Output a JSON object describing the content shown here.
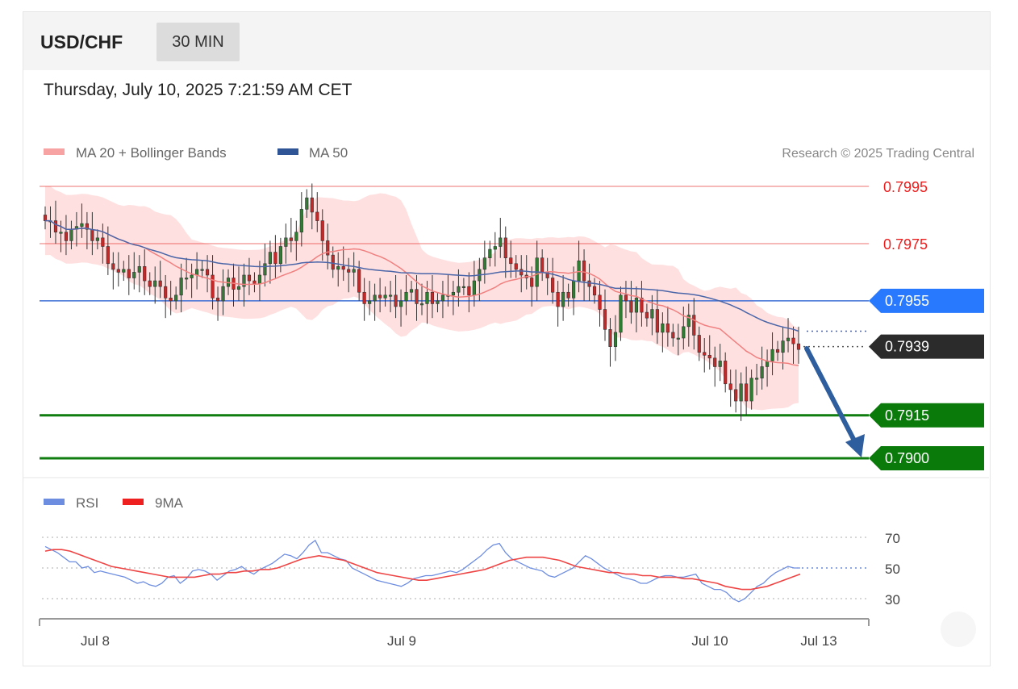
{
  "header": {
    "symbol": "USD/CHF",
    "timeframe": "30 MIN",
    "datetime": "Thursday, July 10, 2025 7:21:59 AM CET"
  },
  "legend": {
    "ma20_bb": "MA 20 + Bollinger Bands",
    "ma50": "MA 50",
    "credit": "Research © 2025 Trading Central"
  },
  "rsi_legend": {
    "rsi": "RSI",
    "ma9": "9MA"
  },
  "colors": {
    "bull": "#2e7d32",
    "bear": "#c62828",
    "band": "#ffd6d6",
    "ma20": "#f08080",
    "ma50": "#4a66a8",
    "resistance": "#e53935",
    "pivot": "#2979ff",
    "support": "#0a7a0a",
    "current": "#2b2b2b",
    "arrow": "#2e5e9e",
    "rsi": "#6d8de0",
    "rsi_ma": "#ef4444"
  },
  "chart_data": [
    {
      "type": "candlestick",
      "title": "USD/CHF 30 MIN",
      "ylim": [
        0.7892,
        0.8005
      ],
      "x_ticks": [
        "Jul 8",
        "Jul 9",
        "Jul 10",
        "Jul 13"
      ],
      "levels": [
        {
          "value": 0.7995,
          "label": "0.7995",
          "role": "resistance"
        },
        {
          "value": 0.7975,
          "label": "0.7975",
          "role": "resistance"
        },
        {
          "value": 0.7955,
          "label": "0.7955",
          "role": "pivot"
        },
        {
          "value": 0.7939,
          "label": "0.7939",
          "role": "current"
        },
        {
          "value": 0.7915,
          "label": "0.7915",
          "role": "support"
        },
        {
          "value": 0.79,
          "label": "0.7900",
          "role": "support"
        }
      ],
      "closes": [
        0.7983,
        0.7983,
        0.7979,
        0.7979,
        0.7976,
        0.798,
        0.7981,
        0.7982,
        0.798,
        0.7976,
        0.7977,
        0.7974,
        0.7968,
        0.7966,
        0.7965,
        0.7966,
        0.7963,
        0.7965,
        0.7967,
        0.7962,
        0.796,
        0.7962,
        0.796,
        0.7956,
        0.7955,
        0.7957,
        0.7963,
        0.7963,
        0.7964,
        0.7966,
        0.7966,
        0.7964,
        0.7956,
        0.7955,
        0.796,
        0.7963,
        0.7959,
        0.796,
        0.7964,
        0.7962,
        0.7961,
        0.7964,
        0.7968,
        0.7972,
        0.7968,
        0.7974,
        0.7977,
        0.7976,
        0.7979,
        0.7987,
        0.7991,
        0.7986,
        0.7983,
        0.7976,
        0.7971,
        0.7966,
        0.7967,
        0.7966,
        0.7965,
        0.7966,
        0.7958,
        0.7954,
        0.7955,
        0.7957,
        0.7956,
        0.7957,
        0.7957,
        0.7953,
        0.7955,
        0.7958,
        0.7959,
        0.7954,
        0.7954,
        0.7958,
        0.7954,
        0.7955,
        0.7957,
        0.7957,
        0.7958,
        0.796,
        0.796,
        0.7957,
        0.7962,
        0.7966,
        0.797,
        0.7973,
        0.7974,
        0.7977,
        0.797,
        0.7968,
        0.7966,
        0.7964,
        0.7963,
        0.796,
        0.797,
        0.7965,
        0.7963,
        0.7958,
        0.7953,
        0.7958,
        0.7956,
        0.7962,
        0.7969,
        0.7962,
        0.796,
        0.7957,
        0.7952,
        0.7945,
        0.7939,
        0.7944,
        0.7957,
        0.7955,
        0.7951,
        0.7956,
        0.7951,
        0.7949,
        0.7952,
        0.7944,
        0.7947,
        0.7944,
        0.7942,
        0.7942,
        0.7946,
        0.795,
        0.7943,
        0.7937,
        0.7936,
        0.7935,
        0.7932,
        0.7934,
        0.7926,
        0.7924,
        0.792,
        0.7926,
        0.792,
        0.7928,
        0.7928,
        0.7932,
        0.7934,
        0.7938,
        0.7937,
        0.7941,
        0.7942,
        0.794,
        0.7938
      ]
    },
    {
      "type": "line",
      "title": "RSI",
      "ylim": [
        20,
        80
      ],
      "y_ticks": [
        30,
        50,
        70
      ],
      "series": [
        {
          "name": "RSI",
          "values": [
            64,
            62,
            60,
            57,
            54,
            54,
            50,
            51,
            47,
            48,
            47,
            46,
            45,
            44,
            42,
            40,
            41,
            39,
            38,
            40,
            44,
            45,
            40,
            43,
            48,
            49,
            48,
            46,
            42,
            45,
            48,
            49,
            51,
            48,
            46,
            49,
            51,
            53,
            56,
            59,
            58,
            56,
            60,
            65,
            68,
            60,
            60,
            58,
            56,
            55,
            50,
            48,
            46,
            44,
            42,
            41,
            40,
            39,
            38,
            40,
            43,
            44,
            45,
            45,
            46,
            47,
            48,
            47,
            49,
            52,
            55,
            58,
            62,
            65,
            66,
            60,
            56,
            54,
            52,
            50,
            49,
            48,
            45,
            44,
            46,
            48,
            50,
            54,
            58,
            56,
            53,
            50,
            48,
            46,
            44,
            43,
            42,
            40,
            40,
            42,
            44,
            45,
            45,
            44,
            44,
            45,
            46,
            40,
            38,
            36,
            36,
            34,
            30,
            28,
            30,
            34,
            38,
            40,
            44,
            47,
            49,
            51,
            50,
            50
          ]
        },
        {
          "name": "9MA",
          "values": [
            61,
            62,
            62,
            61,
            59,
            57,
            55,
            53,
            51,
            50,
            49,
            48,
            47,
            46,
            45,
            44,
            44,
            44,
            44,
            45,
            46,
            46,
            47,
            47,
            48,
            48,
            49,
            49,
            50,
            52,
            54,
            56,
            57,
            58,
            57,
            56,
            55,
            53,
            51,
            49,
            47,
            46,
            45,
            44,
            43,
            42,
            42,
            43,
            44,
            45,
            46,
            47,
            48,
            49,
            51,
            53,
            55,
            56,
            57,
            57,
            57,
            56,
            55,
            53,
            51,
            50,
            49,
            48,
            47,
            47,
            46,
            46,
            45,
            45,
            44,
            44,
            44,
            43,
            43,
            42,
            41,
            40,
            38,
            37,
            36,
            36,
            37,
            38,
            40,
            42,
            44,
            46
          ]
        }
      ]
    }
  ]
}
